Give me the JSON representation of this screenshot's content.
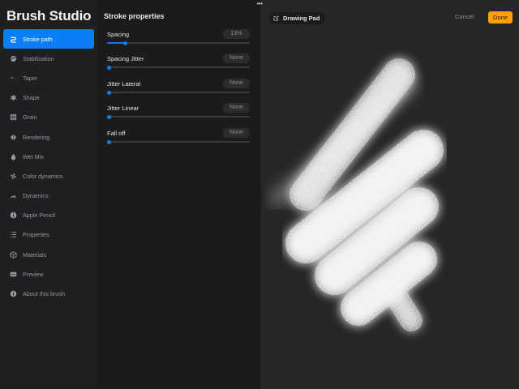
{
  "app": {
    "title": "Brush Studio"
  },
  "sidebar": {
    "items": [
      {
        "label": "Stroke path",
        "icon": "stroke-path-icon",
        "active": true
      },
      {
        "label": "Stabilization",
        "icon": "stabilization-icon",
        "active": false
      },
      {
        "label": "Taper",
        "icon": "taper-icon",
        "active": false
      },
      {
        "label": "Shape",
        "icon": "shape-icon",
        "active": false
      },
      {
        "label": "Grain",
        "icon": "grain-icon",
        "active": false
      },
      {
        "label": "Rendering",
        "icon": "rendering-icon",
        "active": false
      },
      {
        "label": "Wet Mix",
        "icon": "wet-mix-icon",
        "active": false
      },
      {
        "label": "Color dynamics",
        "icon": "color-dynamics-icon",
        "active": false
      },
      {
        "label": "Dynamics",
        "icon": "dynamics-icon",
        "active": false
      },
      {
        "label": "Apple Pencil",
        "icon": "apple-pencil-icon",
        "active": false
      },
      {
        "label": "Properties",
        "icon": "properties-icon",
        "active": false
      },
      {
        "label": "Materials",
        "icon": "materials-icon",
        "active": false
      },
      {
        "label": "Preview",
        "icon": "preview-icon",
        "active": false
      },
      {
        "label": "About this brush",
        "icon": "about-icon",
        "active": false
      }
    ]
  },
  "panel": {
    "title": "Stroke properties",
    "properties": [
      {
        "label": "Spacing",
        "value": "13%",
        "level": 0.13
      },
      {
        "label": "Spacing Jitter",
        "value": "None",
        "level": 0
      },
      {
        "label": "Jitter Lateral",
        "value": "None",
        "level": 0
      },
      {
        "label": "Jitter Linear",
        "value": "None",
        "level": 0
      },
      {
        "label": "Fall off",
        "value": "None",
        "level": 0
      }
    ]
  },
  "drawing_pad": {
    "label": "Drawing Pad",
    "icon": "edit-icon"
  },
  "toolbar": {
    "cancel_label": "Cancel",
    "done_label": "Done",
    "more_icon": "more-icon"
  },
  "colors": {
    "accent": "#0a7ef4",
    "done": "#ff9f0a",
    "background": "#1c1c1e",
    "canvas": "#262628"
  }
}
